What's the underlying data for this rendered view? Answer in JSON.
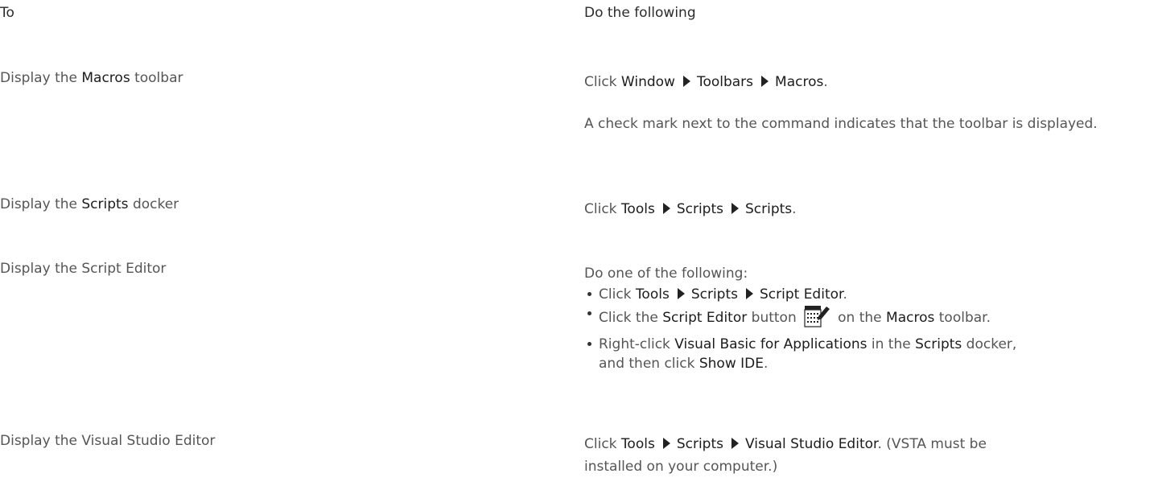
{
  "headers": {
    "to": "To",
    "do": "Do the following"
  },
  "rows": [
    {
      "task_prefix": "Display the ",
      "task_strong": "Macros",
      "task_suffix": " toolbar",
      "do_click": "Click ",
      "menu": [
        "Window",
        "Toolbars",
        "Macros"
      ],
      "end": ".",
      "note": "A check mark next to the command indicates that the toolbar is displayed."
    },
    {
      "task_prefix": "Display the ",
      "task_strong": "Scripts",
      "task_suffix": " docker",
      "do_click": "Click ",
      "menu": [
        "Tools",
        "Scripts",
        "Scripts"
      ],
      "end": "."
    },
    {
      "task": "Display the Script Editor",
      "intro": "Do one of the following:",
      "bullet1": {
        "click": "Click ",
        "menu": [
          "Tools",
          "Scripts",
          "Script Editor"
        ],
        "end": "."
      },
      "bullet2": {
        "a": "Click the ",
        "b": "Script Editor",
        "c": " button",
        "d": " on the ",
        "e": "Macros",
        "f": " toolbar."
      },
      "bullet3": {
        "a": "Right-click ",
        "b": "Visual Basic for Applications",
        "c": " in the ",
        "d": "Scripts",
        "e": " docker,",
        "f": "and then click ",
        "g": "Show IDE",
        "h": "."
      }
    },
    {
      "task": "Display the Visual Studio Editor",
      "do_click": "Click ",
      "menu": [
        "Tools",
        "Scripts",
        "Visual Studio Editor"
      ],
      "end": ". (VSTA must be",
      "end2": "installed on your computer.)"
    }
  ],
  "icon": "script-editor-icon"
}
